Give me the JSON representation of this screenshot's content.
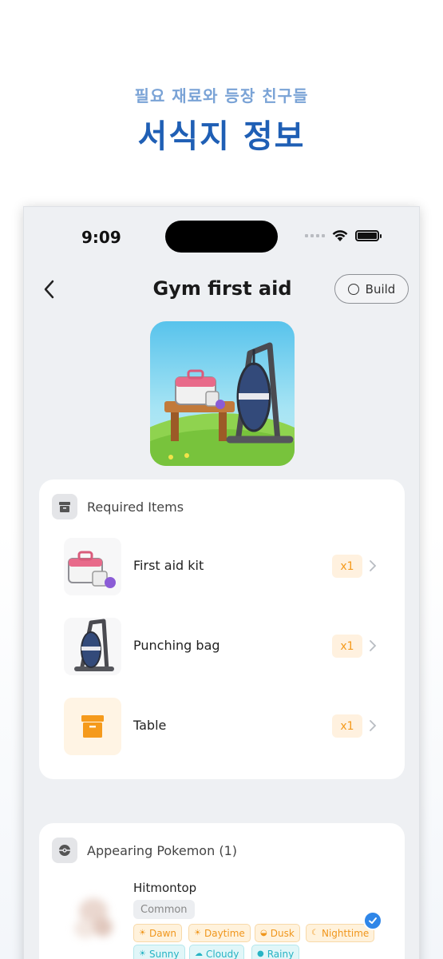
{
  "promo": {
    "subtitle": "필요 재료와 등장 친구들",
    "title": "서식지 정보"
  },
  "status_bar": {
    "time": "9:09"
  },
  "nav": {
    "title": "Gym first aid",
    "build_label": "Build"
  },
  "required_items": {
    "header": "Required Items",
    "items": [
      {
        "name": "First aid kit",
        "qty": "x1"
      },
      {
        "name": "Punching bag",
        "qty": "x1"
      },
      {
        "name": "Table",
        "qty": "x1"
      }
    ]
  },
  "appearing": {
    "header": "Appearing Pokemon (1)",
    "pokemon": {
      "name": "Hitmontop",
      "rarity": "Common",
      "times": [
        "Dawn",
        "Daytime",
        "Dusk",
        "Nighttime"
      ],
      "weather": [
        "Sunny",
        "Cloudy",
        "Rainy"
      ],
      "caught": true
    }
  },
  "colors": {
    "promo_subtitle": "#7aa3d6",
    "promo_title": "#1f5fb5",
    "qty_text": "#f59a1c",
    "qty_bg": "#fff1df",
    "time_tag": "#f0961c",
    "weather_tag": "#27b3c4",
    "check": "#2f86e8"
  }
}
